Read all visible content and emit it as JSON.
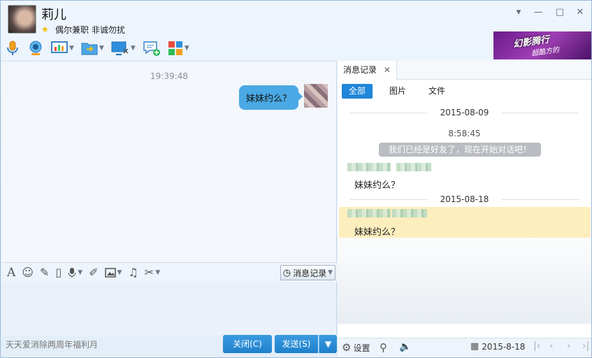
{
  "header": {
    "username": "莉儿",
    "signature": "偶尔兼职  非诚勿扰",
    "ad_title": "幻影腾行",
    "ad_subtitle": "超酷方的"
  },
  "window_controls": {
    "dropdown": "▾",
    "minimize": "—",
    "maximize": "□",
    "close": "✕"
  },
  "chat": {
    "timestamp": "19:39:48",
    "message": "妹妹约么？"
  },
  "input_toolbar": {
    "history_label": "消息记录"
  },
  "footer": {
    "promo_text": "天天爱消除两周年福利月",
    "close_label": "关闭(C)",
    "send_label": "发送(S)"
  },
  "history_panel": {
    "tab_label": "消息记录",
    "filters": [
      "全部",
      "图片",
      "文件"
    ],
    "date1": "2015-08-09",
    "sys_time": "8:58:45",
    "sys_message": "我们已经是好友了，现在开始对话吧！",
    "msg1": "妹妹约么？",
    "date2": "2015-08-18",
    "msg2": "妹妹约么？"
  },
  "history_footer": {
    "settings_label": "设置",
    "date": "2015-8-18"
  },
  "colors": {
    "accent": "#1f86d9",
    "bubble": "#4aa8e4",
    "highlight": "#fdeebe"
  }
}
